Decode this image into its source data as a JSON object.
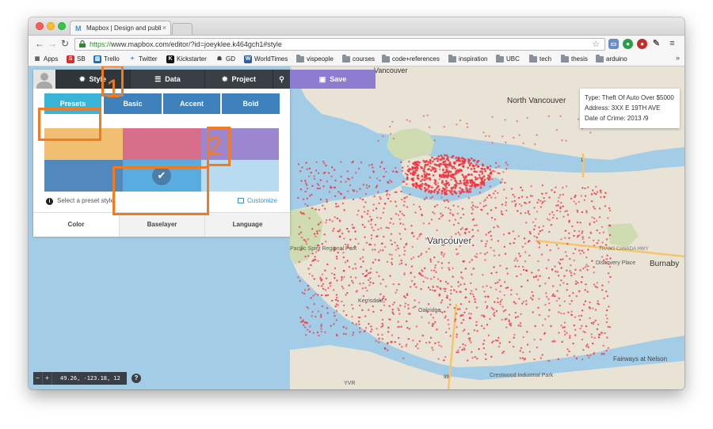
{
  "browser": {
    "tab_title": "Mapbox | Design and publi",
    "tab_favicon": "M",
    "url_scheme": "https://",
    "url_rest": "www.mapbox.com/editor/?id=joeyklee.k464gch1#style",
    "bookmarks": [
      {
        "label": "Apps",
        "icon": "apps-grid-icon"
      },
      {
        "label": "SB",
        "icon": "sb-icon"
      },
      {
        "label": "Trello",
        "icon": "trello-icon"
      },
      {
        "label": "Twitter",
        "icon": "twitter-bird-icon"
      },
      {
        "label": "Kickstarter",
        "icon": "kickstarter-icon"
      },
      {
        "label": "GD",
        "icon": "gd-icon"
      },
      {
        "label": "WorldTimes",
        "icon": "worldtimes-icon"
      },
      {
        "label": "vispeople",
        "icon": "folder-icon"
      },
      {
        "label": "courses",
        "icon": "folder-icon"
      },
      {
        "label": "code+references",
        "icon": "folder-icon"
      },
      {
        "label": "inspiration",
        "icon": "folder-icon"
      },
      {
        "label": "UBC",
        "icon": "folder-icon"
      },
      {
        "label": "tech",
        "icon": "folder-icon"
      },
      {
        "label": "thesis",
        "icon": "folder-icon"
      },
      {
        "label": "arduino",
        "icon": "folder-icon"
      }
    ],
    "more": "»"
  },
  "editor": {
    "nav": {
      "style": "Style",
      "data": "Data",
      "project": "Project",
      "save": "Save"
    },
    "subtabs": {
      "presets": "Presets",
      "basic": "Basic",
      "accent": "Accent",
      "bold": "Bold"
    },
    "swatch_colors": [
      "#f2be72",
      "#d86f8a",
      "#9c86cf",
      "#5189bf",
      "#59acdf",
      "#b9dbef"
    ],
    "selected_swatch": 5,
    "hint": "Select a preset style.",
    "customize": "Customize",
    "bottom_tabs": {
      "color": "Color",
      "baselayer": "Baselayer",
      "language": "Language"
    },
    "coords": "49.26, -123.18, 12",
    "zoom_out": "−",
    "zoom_in": "+",
    "help": "?"
  },
  "infobox": {
    "type": "Type: Theft Of Auto Over $5000",
    "address": "Address: 3XX E 19TH AVE",
    "date": "Date of Crime: 2013 /9"
  },
  "map": {
    "labels": {
      "vancouver": "Vancouver",
      "north_vancouver": "North Vancouver",
      "burnaby": "Burnaby",
      "discovery_place": "Discovery Place",
      "pacific_spirit_park": "Pacific Spirit Regional Park",
      "fairways_at_nelson": "Fairways at Nelson",
      "crestwood": "Crestwood Industrial Park",
      "yvr": "YVR",
      "west_vancouver_label": "Vancouver",
      "kerrisdale": "Kerrisdale",
      "oakridge": "Oakridge",
      "trans_canada": "TRANS CANADA HWY",
      "route_1": "1",
      "route_99": "99"
    },
    "colors": {
      "water": "#a3cde6",
      "land": "#e9e3d6",
      "park": "#cfdcb2",
      "points": "#f0323f"
    }
  },
  "annotations": {
    "one": "1",
    "two": "2",
    "color": "#f07b22"
  }
}
